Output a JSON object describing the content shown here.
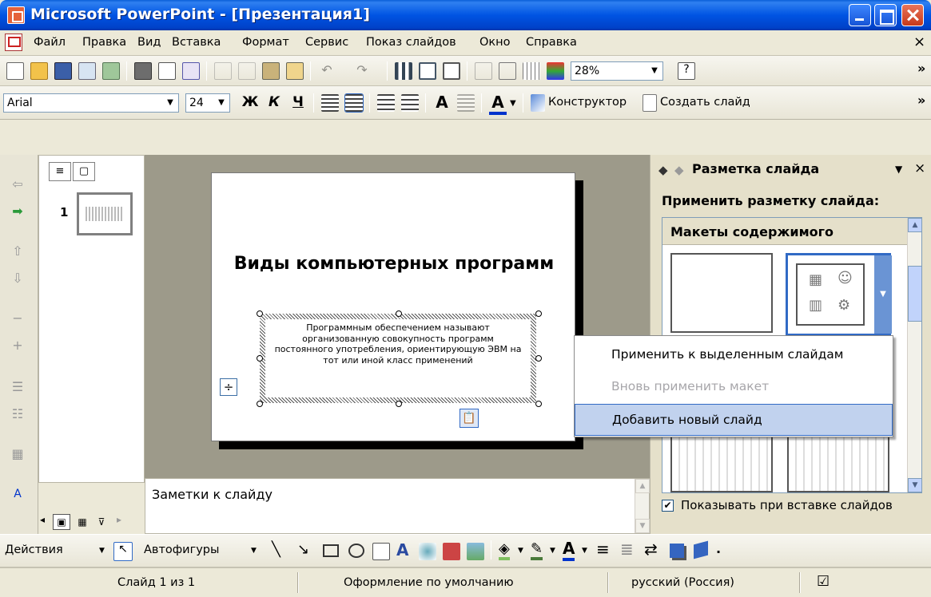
{
  "window": {
    "title": "Microsoft PowerPoint - [Презентация1]"
  },
  "menu": {
    "items": [
      "Файл",
      "Правка",
      "Вид",
      "Вставка",
      "Формат",
      "Сервис",
      "Показ слайдов",
      "Окно",
      "Справка"
    ],
    "close_glyph": "×"
  },
  "standard_toolbar": {
    "zoom": "28%",
    "more": "»"
  },
  "formatting_toolbar": {
    "font_name": "Arial",
    "font_size": "24",
    "bold": "Ж",
    "italic": "К",
    "underline": "Ч",
    "font_color_letter": "A",
    "designer": "Конструктор",
    "new_slide": "Создать слайд",
    "more": "»"
  },
  "slides_panel": {
    "slide_number": "1"
  },
  "slide": {
    "title": "Виды компьютерных программ",
    "body": "Программным обеспечением называют организованную совокупность программ постоянного употребления, ориентирующую ЭВМ на тот или иной класс применений"
  },
  "notes": {
    "placeholder": "Заметки к слайду"
  },
  "task_pane": {
    "title": "Разметка слайда",
    "apply_label": "Применить разметку слайда:",
    "category": "Макеты содержимого",
    "show_on_insert": "Показывать при вставке слайдов",
    "show_on_insert_checked": "✔"
  },
  "context_menu": {
    "items": [
      {
        "label": "Применить к выделенным слайдам",
        "state": "normal"
      },
      {
        "label": "Вновь применить макет",
        "state": "disabled"
      },
      {
        "label": "Добавить новый слайд",
        "state": "highlighted"
      }
    ]
  },
  "drawing_toolbar": {
    "actions": "Действия",
    "autoshapes": "Автофигуры"
  },
  "status_bar": {
    "slide_pos": "Слайд 1 из 1",
    "design": "Оформление по умолчанию",
    "language": "русский (Россия)"
  },
  "colors": {
    "title_bar": "#0054e3",
    "highlight": "#c1d2ee",
    "highlight_border": "#316ac5"
  }
}
